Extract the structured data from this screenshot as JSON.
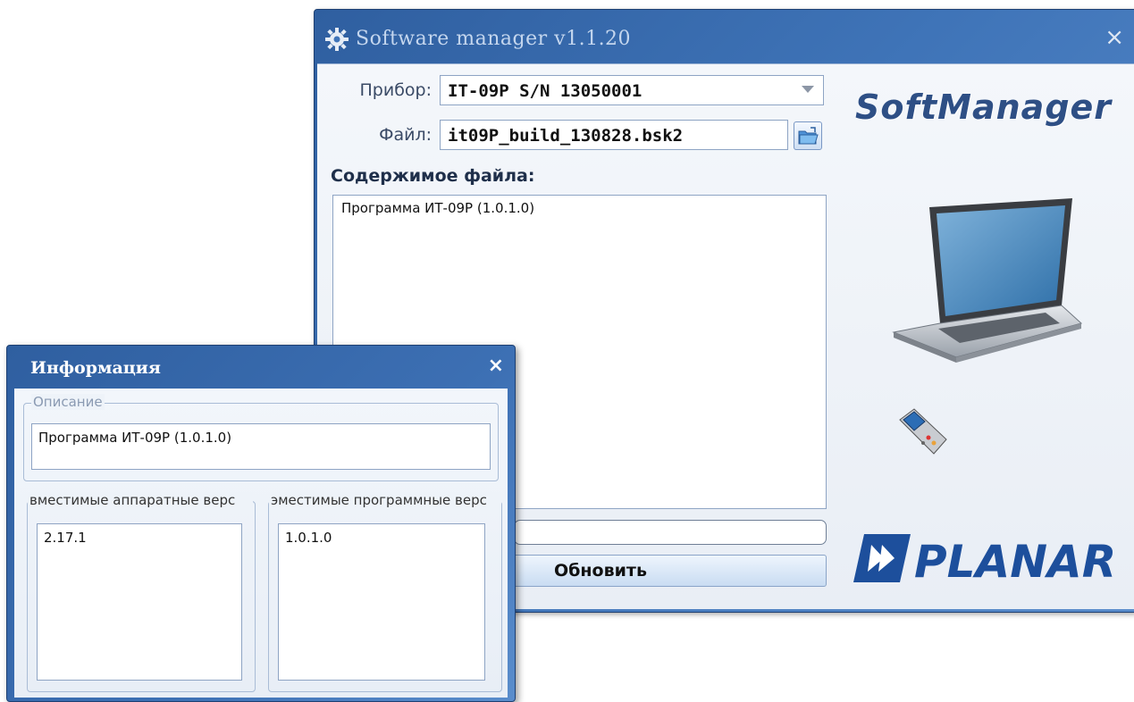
{
  "main_window": {
    "title": "Software manager v1.1.20",
    "close_glyph": "×",
    "device_label": "Прибор:",
    "device_value": "IT-09P S/N 13050001",
    "file_label": "Файл:",
    "file_value": "it09P_build_130828.bsk2",
    "contents_label": "Содержимое файла:",
    "contents_items": [
      "Программа ИТ-09Р (1.0.1.0)"
    ],
    "status_value": "",
    "update_button": "Обновить",
    "brand_text": "SoftManager",
    "logo_text": "PLANAR"
  },
  "info_dialog": {
    "title": "Информация",
    "close_glyph": "×",
    "description_legend": "Описание",
    "description_value": "Программа ИТ-09Р (1.0.1.0)",
    "hw_legend": "вместимые аппаратные верс",
    "hw_values": [
      "2.17.1"
    ],
    "sw_legend": "эместимые программные верс",
    "sw_values": [
      "1.0.1.0"
    ]
  },
  "icons": [
    "gear-icon",
    "close-icon",
    "dropdown-arrow-icon",
    "open-folder-icon",
    "laptop-icon",
    "handheld-device-icon",
    "planar-logo"
  ],
  "colors": {
    "title_bar": "#3f74b8",
    "client_bg": "#eef3f9",
    "brand": "#2e4f85",
    "logo_blue": "#1d4f9c"
  }
}
